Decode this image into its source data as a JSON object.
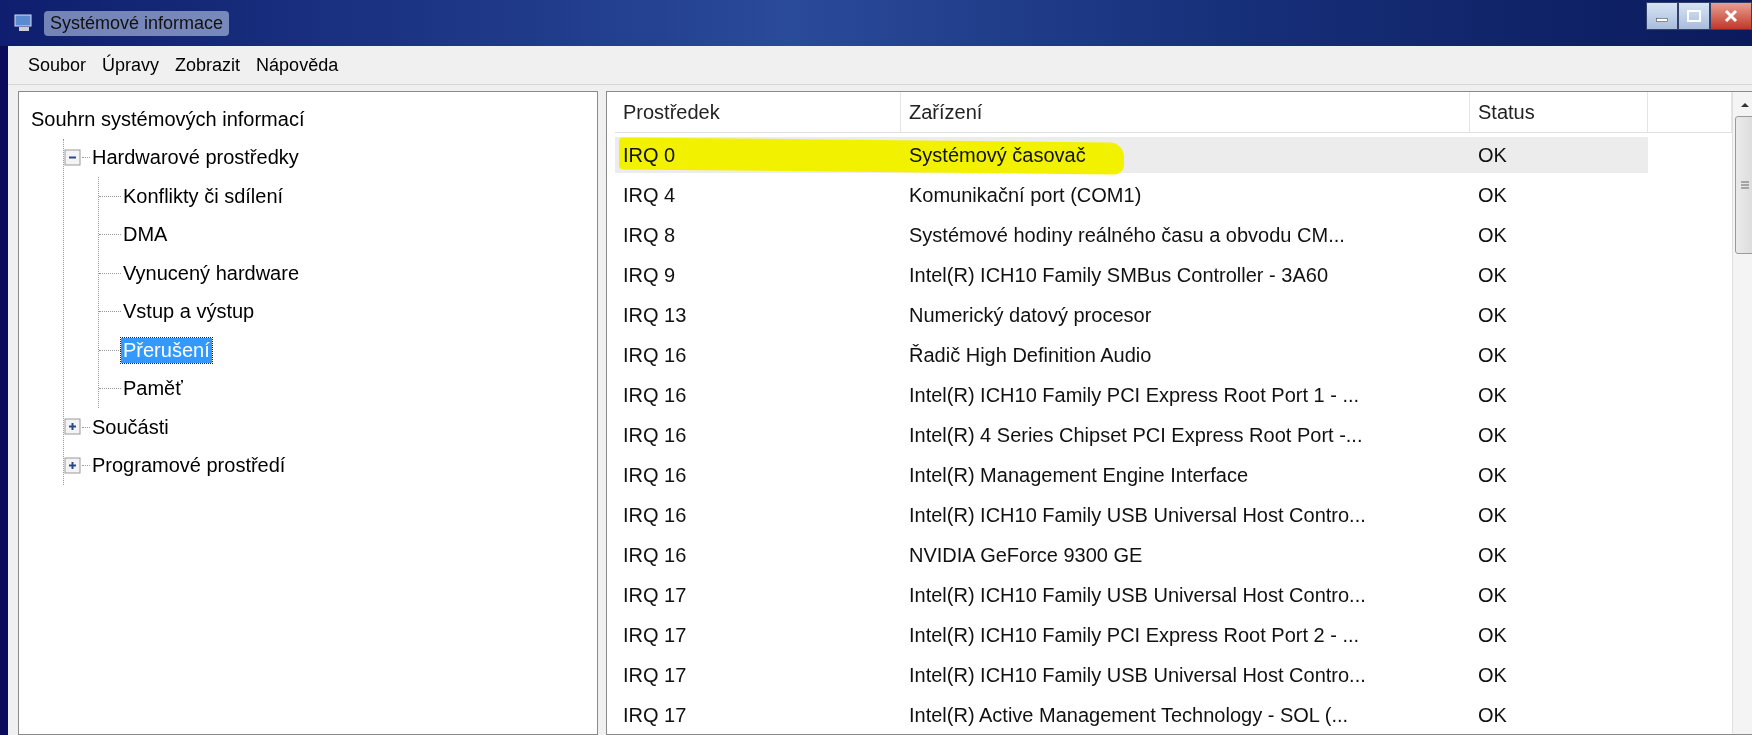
{
  "window": {
    "title": "Systémové informace"
  },
  "menu": [
    "Soubor",
    "Úpravy",
    "Zobrazit",
    "Nápověda"
  ],
  "tree": {
    "label": "Souhrn systémových informací",
    "children": [
      {
        "label": "Hardwarové prostředky",
        "expanded": true,
        "selected": false,
        "children": [
          {
            "label": "Konflikty či sdílení",
            "selected": false
          },
          {
            "label": "DMA",
            "selected": false
          },
          {
            "label": "Vynucený hardware",
            "selected": false
          },
          {
            "label": "Vstup a výstup",
            "selected": false
          },
          {
            "label": "Přerušení",
            "selected": true
          },
          {
            "label": "Paměť",
            "selected": false
          }
        ]
      },
      {
        "label": "Součásti",
        "expanded": false,
        "selected": false
      },
      {
        "label": "Programové prostředí",
        "expanded": false,
        "selected": false
      }
    ]
  },
  "table": {
    "columns": [
      "Prostředek",
      "Zařízení",
      "Status"
    ],
    "rows": [
      {
        "cells": [
          "IRQ 0",
          "Systémový časovač",
          "OK"
        ],
        "selected": true,
        "highlighted": true
      },
      {
        "cells": [
          "IRQ 4",
          "Komunikační port (COM1)",
          "OK"
        ],
        "selected": false,
        "highlighted": false
      },
      {
        "cells": [
          "IRQ 8",
          "Systémové hodiny reálného času a obvodu CM...",
          "OK"
        ],
        "selected": false,
        "highlighted": false
      },
      {
        "cells": [
          "IRQ 9",
          "Intel(R) ICH10 Family SMBus Controller - 3A60",
          "OK"
        ],
        "selected": false,
        "highlighted": false
      },
      {
        "cells": [
          "IRQ 13",
          "Numerický datový procesor",
          "OK"
        ],
        "selected": false,
        "highlighted": false
      },
      {
        "cells": [
          "IRQ 16",
          "Řadič High Definition Audio",
          "OK"
        ],
        "selected": false,
        "highlighted": false
      },
      {
        "cells": [
          "IRQ 16",
          "Intel(R) ICH10 Family PCI Express Root Port 1 - ...",
          "OK"
        ],
        "selected": false,
        "highlighted": false
      },
      {
        "cells": [
          "IRQ 16",
          "Intel(R) 4 Series Chipset PCI Express Root Port -...",
          "OK"
        ],
        "selected": false,
        "highlighted": false
      },
      {
        "cells": [
          "IRQ 16",
          "Intel(R) Management Engine Interface",
          "OK"
        ],
        "selected": false,
        "highlighted": false
      },
      {
        "cells": [
          "IRQ 16",
          "Intel(R) ICH10 Family USB Universal Host Contro...",
          "OK"
        ],
        "selected": false,
        "highlighted": false
      },
      {
        "cells": [
          "IRQ 16",
          "NVIDIA GeForce 9300 GE",
          "OK"
        ],
        "selected": false,
        "highlighted": false
      },
      {
        "cells": [
          "IRQ 17",
          "Intel(R) ICH10 Family USB Universal Host Contro...",
          "OK"
        ],
        "selected": false,
        "highlighted": false
      },
      {
        "cells": [
          "IRQ 17",
          "Intel(R) ICH10 Family PCI Express Root Port 2 - ...",
          "OK"
        ],
        "selected": false,
        "highlighted": false
      },
      {
        "cells": [
          "IRQ 17",
          "Intel(R) ICH10 Family USB Universal Host Contro...",
          "OK"
        ],
        "selected": false,
        "highlighted": false
      },
      {
        "cells": [
          "IRQ 17",
          "Intel(R) Active Management Technology - SOL (...",
          "OK"
        ],
        "selected": false,
        "highlighted": false
      }
    ]
  }
}
